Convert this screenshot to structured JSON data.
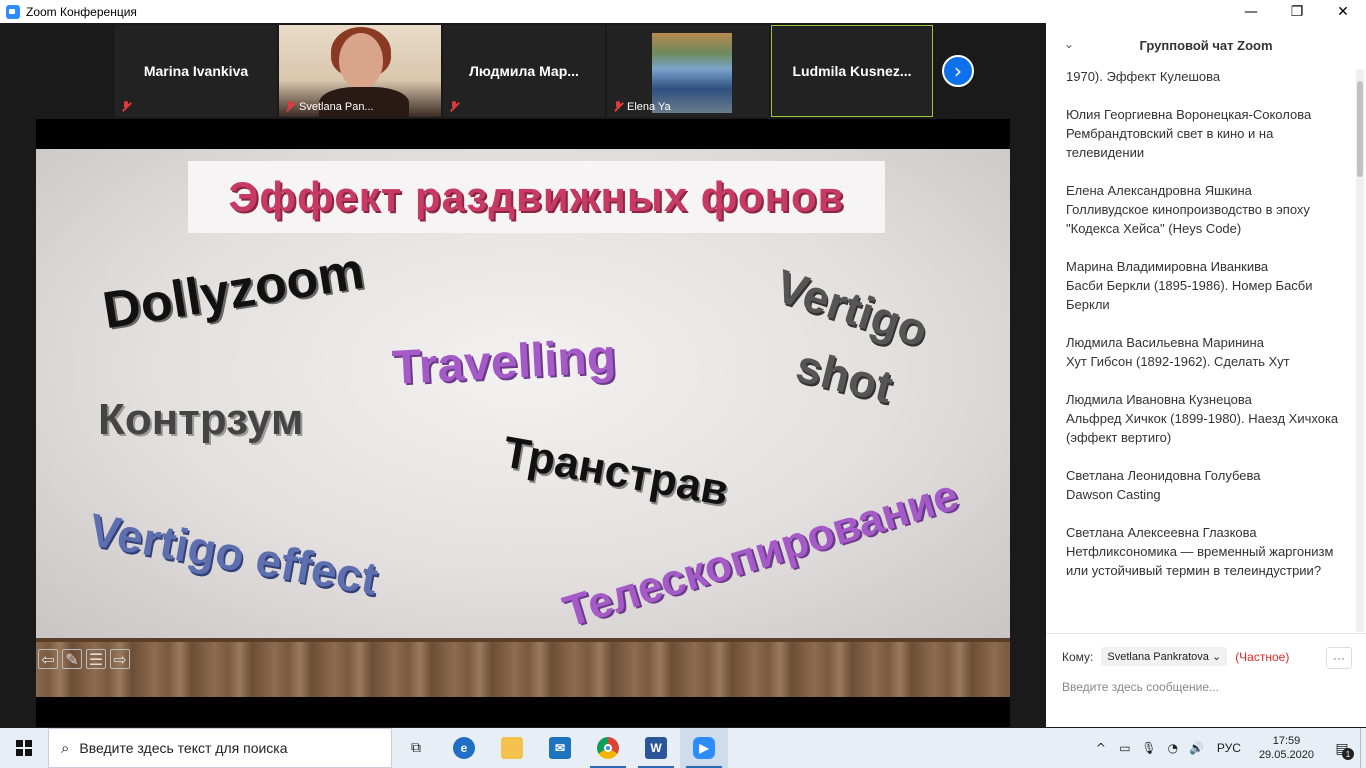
{
  "window": {
    "title": "Zoom Конференция",
    "controls": {
      "minimize": "—",
      "maximize": "❐",
      "close": "✕"
    }
  },
  "participants": [
    {
      "name": "Marina Ivankiva",
      "label": "",
      "has_video": false
    },
    {
      "name": "",
      "label": "Svetlana Pan...",
      "has_video": true
    },
    {
      "name": "Людмила  Мар...",
      "label": "",
      "has_video": false
    },
    {
      "name": "",
      "label": "Elena Ya",
      "has_video": true
    },
    {
      "name": "Ludmila  Kusnez...",
      "label": "",
      "has_video": false,
      "active_speaker": true
    }
  ],
  "next_page_icon": "chevron-right-icon",
  "slide": {
    "headline": "Эффект раздвижных фонов",
    "words": {
      "dollyzoom": "Dollyzoom",
      "travelling": "Travelling",
      "vertigo_shot_1": "Vertigo",
      "vertigo_shot_2": "shot",
      "kontrzum": "Контрзум",
      "transtrav": "Транстрав",
      "vertigo_effect": "Vertigo effect",
      "teleskop": "Телескопирование"
    },
    "nav": {
      "prev": "⇦",
      "pen": "✎",
      "menu": "☰",
      "next": "⇨"
    }
  },
  "chat": {
    "title": "Групповой чат Zoom",
    "collapse_icon": "chevron-down-icon",
    "messages": [
      {
        "lines": [
          "1970). Эффект Кулешова"
        ]
      },
      {
        "lines": [
          "Юлия Георгиевна Воронецкая-Соколова",
          "Рембрандтовский свет в кино и на телевидении"
        ]
      },
      {
        "lines": [
          "Елена Александровна Яшкина",
          "Голливудское кинопроизводство в эпоху \"Кодекса Хейса\" (Heys  Code)"
        ]
      },
      {
        "lines": [
          "Марина Владимировна Иванкива",
          "Басби Беркли (1895-1986). Номер Басби Беркли"
        ]
      },
      {
        "lines": [
          "Людмила Васильевна Маринина",
          "Хут Гибсон (1892-1962). Сделать Хут"
        ]
      },
      {
        "lines": [
          "Людмила Ивановна Кузнецова",
          "Альфред Хичкок (1899-1980). Наезд Хичхока (эффект вертиго)"
        ]
      },
      {
        "lines": [
          "Светлана Леонидовна Голубева",
          "Dawson Casting"
        ]
      },
      {
        "lines": [
          "Светлана Алексеевна Глазкова",
          "Нетфликсономика — временный жаргонизм или устойчивый термин в телеиндустрии?"
        ]
      }
    ],
    "to_label": "Кому:",
    "recipient": "Svetlana Pankratova",
    "private_label": "(Частное)",
    "more_label": "···",
    "input_placeholder": "Введите здесь сообщение..."
  },
  "taskbar": {
    "search_placeholder": "Введите здесь текст для поиска",
    "apps": [
      "task-view",
      "edge",
      "file-explorer",
      "mail",
      "chrome",
      "word",
      "zoom"
    ],
    "tray": {
      "language": "РУС",
      "time": "17:59",
      "date": "29.05.2020",
      "notifications": "1"
    }
  },
  "colors": {
    "zoom_blue": "#2d8cff",
    "headline": "#c73a64",
    "purple_text": "#a45ac7",
    "blue_text": "#5e6fb0",
    "private": "#e02828",
    "active_border": "#9bc53d"
  }
}
